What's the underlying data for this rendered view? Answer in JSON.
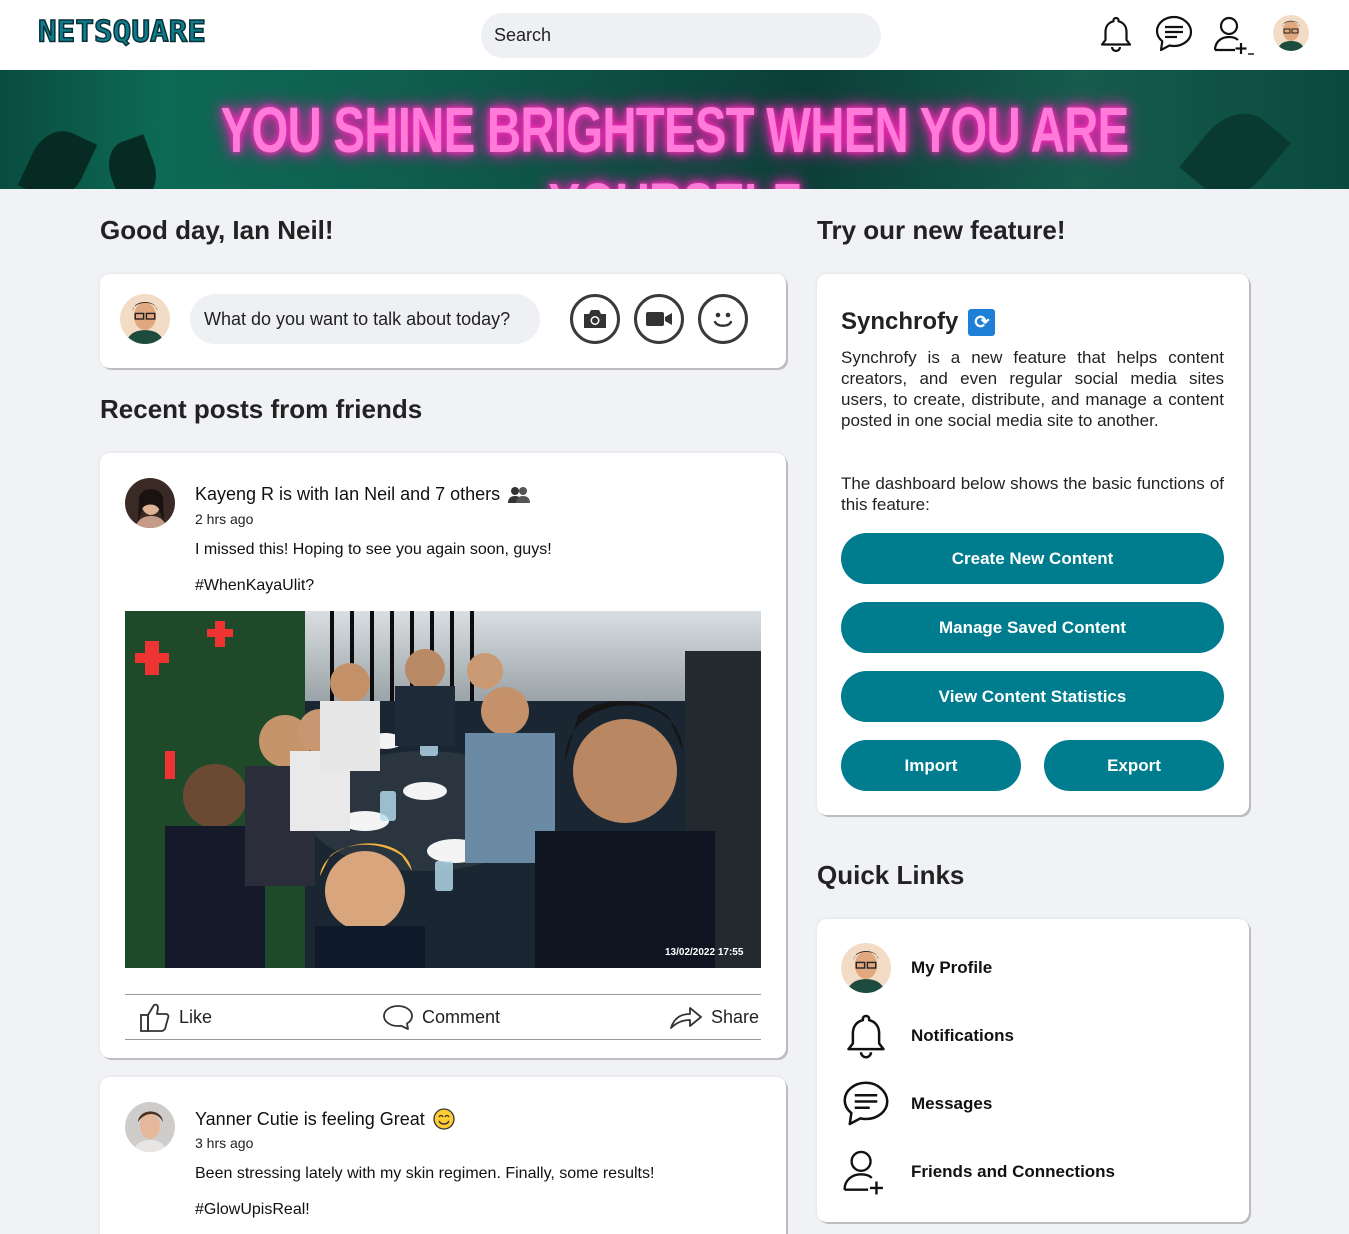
{
  "header": {
    "logo": "NETSQUARE",
    "search_placeholder": "Search"
  },
  "banner": {
    "text": "YOU SHINE BRIGHTEST WHEN YOU ARE YOURSELF"
  },
  "greeting": "Good day, Ian Neil!",
  "composer": {
    "placeholder": "What do you want to talk about today?"
  },
  "recent_heading": "Recent posts from friends",
  "posts": [
    {
      "author_line": "Kayeng R is with Ian Neil and 7 others",
      "time": "2 hrs ago",
      "text": "I missed this! Hoping to see you again soon, guys!",
      "hashtag": "#WhenKayaUlit?",
      "photo_timestamp": "13/02/2022 17:55",
      "actions": {
        "like": "Like",
        "comment": "Comment",
        "share": "Share"
      }
    },
    {
      "author_line": "Yanner Cutie is feeling Great",
      "time": "3 hrs ago",
      "text": "Been stressing lately with my skin regimen. Finally, some results!",
      "hashtag": "#GlowUpisReal!"
    }
  ],
  "feature_heading": "Try our new feature!",
  "synchrofy": {
    "title": "Synchrofy",
    "description": "Synchrofy is a new feature that helps content creators, and even regular social media sites users, to create, distribute, and manage a content posted in one social media site to another.",
    "dashboard_note": "The dashboard below shows the basic functions of this feature:",
    "buttons": {
      "create": "Create New Content",
      "manage": "Manage Saved Content",
      "stats": "View Content Statistics",
      "import": "Import",
      "export": "Export"
    }
  },
  "quick_links_heading": "Quick Links",
  "quick_links": [
    {
      "label": "My Profile",
      "icon": "avatar"
    },
    {
      "label": "Notifications",
      "icon": "bell-icon"
    },
    {
      "label": "Messages",
      "icon": "chat-icon"
    },
    {
      "label": "Friends and Connections",
      "icon": "add-friend-icon"
    }
  ],
  "colors": {
    "accent": "#007c8f",
    "page_bg": "#f0f2f5",
    "banner_text": "#ff7ad9"
  }
}
